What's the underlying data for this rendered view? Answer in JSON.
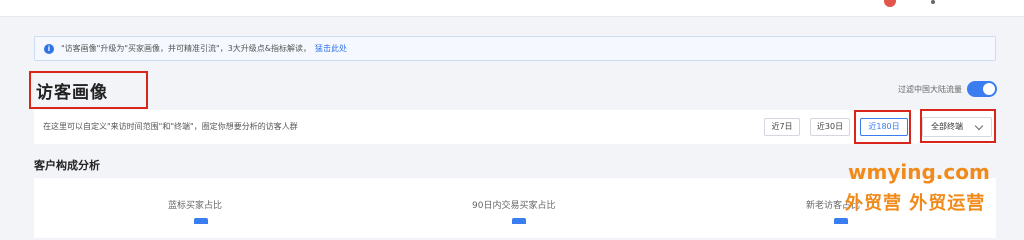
{
  "notice": {
    "text": "\"访客画像\"升级为\"买家画像，并可精准引流\"，3大升级点&指标解读，",
    "link": "猛击此处"
  },
  "page": {
    "title": "访客画像",
    "filter_label": "过滤中国大陆流量"
  },
  "toolbar": {
    "description": "在这里可以自定义\"来访时间范围\"和\"终端\"，圈定你想要分析的访客人群",
    "ranges": [
      "近7日",
      "近30日",
      "近180日"
    ],
    "active_range": "近180日",
    "terminal_select": "全部终端"
  },
  "section": {
    "title": "客户构成分析",
    "metrics": [
      "蓝标买家占比",
      "90日内交易买家占比",
      "新老访客占比"
    ]
  },
  "watermark": {
    "domain": "wmying.com",
    "tagline": "外贸营 外贸运营"
  },
  "colors": {
    "accent": "#3a7df0",
    "highlight": "#d9261c",
    "watermark": "#f08a1b"
  }
}
